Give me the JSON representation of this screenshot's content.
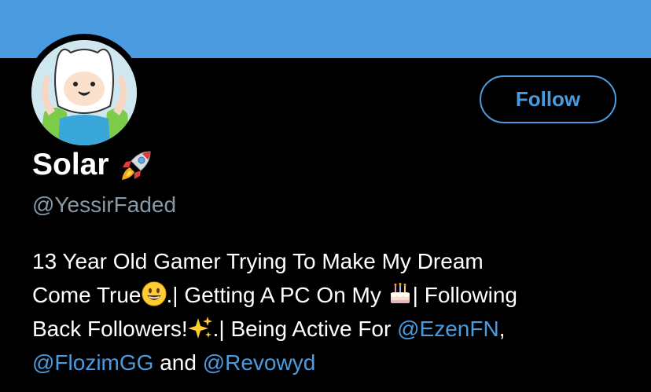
{
  "colors": {
    "banner": "#4a9be0",
    "background": "#000000",
    "text_primary": "#ffffff",
    "text_secondary": "#8899a6",
    "accent": "#4a9be0",
    "follow_border": "#4a9be0"
  },
  "profile": {
    "display_name": "Solar",
    "name_emoji": "rocket-icon",
    "handle": "@YessirFaded",
    "follow_label": "Follow"
  },
  "bio": {
    "line1": "13 Year Old Gamer Trying To Make My Dream",
    "line2_a": "Come True",
    "line2_b": ".| Getting A PC On My ",
    "line2_c": "| Following",
    "line3_a": "Back Followers!",
    "line3_b": ".| Being Active For ",
    "line3_mention": "@EzenFN",
    "line3_end": ",",
    "line4_mention1": "@FlozimGG",
    "line4_and": " and ",
    "line4_mention2": "@Revowyd"
  }
}
